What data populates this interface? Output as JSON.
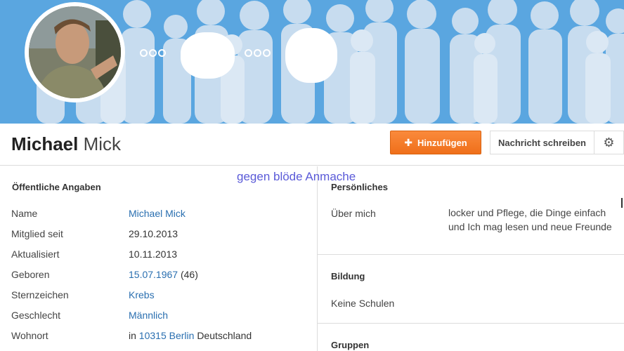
{
  "profile": {
    "first_name": "Michael",
    "last_name": "Mick"
  },
  "actions": {
    "add_label": "Hinzufügen",
    "add_icon": "plus-icon",
    "message_label": "Nachricht schreiben",
    "settings_icon": "gear-icon"
  },
  "overlay_text": "gegen blöde Anmache",
  "public_info": {
    "title": "Öffentliche Angaben",
    "rows": [
      {
        "label": "Name",
        "value": "Michael Mick"
      },
      {
        "label": "Mitglied seit",
        "value": "29.10.2013"
      },
      {
        "label": "Aktualisiert",
        "value": "10.11.2013"
      },
      {
        "label": "Geboren",
        "value_link": "15.07.1967",
        "value_suffix": "(46)"
      },
      {
        "label": "Sternzeichen",
        "value": "Krebs"
      },
      {
        "label": "Geschlecht",
        "value": "Männlich"
      },
      {
        "label": "Wohnort",
        "value_prefix": "in",
        "value_link": "10315 Berlin",
        "value_suffix": "Deutschland"
      }
    ]
  },
  "personal": {
    "title": "Persönliches",
    "about_label": "Über mich",
    "about_line1": "locker und Pflege, die Dinge einfach",
    "about_line2": "und Ich mag lesen und neue Freunde"
  },
  "education": {
    "title": "Bildung",
    "value": "Keine Schulen"
  },
  "groups": {
    "title": "Gruppen"
  },
  "colors": {
    "banner": "#5aa6e0",
    "accent_orange": "#f07a25",
    "link": "#2a6fb0"
  }
}
